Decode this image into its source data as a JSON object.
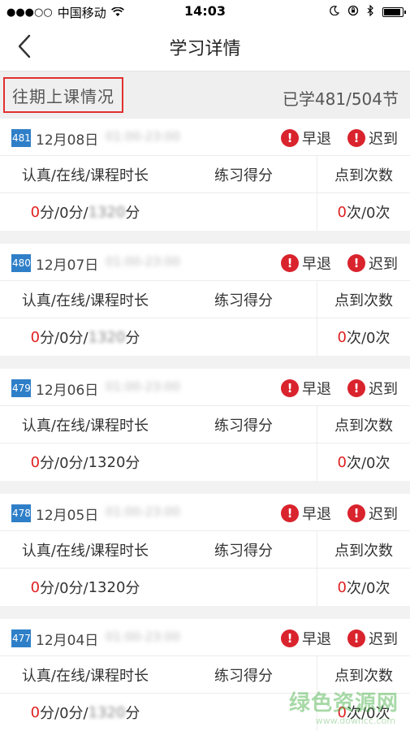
{
  "status_bar": {
    "signal": "●●●○○",
    "carrier": "中国移动",
    "time": "14:03",
    "battery_level": 0.9
  },
  "nav": {
    "title": "学习详情"
  },
  "summary": {
    "history_label": "往期上课情况",
    "progress_text": "已学481/504节"
  },
  "columns": {
    "duration": "认真/在线/课程时长",
    "score": "练习得分",
    "checkin": "点到次数"
  },
  "flags": {
    "leave_early": "早退",
    "late": "迟到",
    "mark": "!"
  },
  "lessons": [
    {
      "number": "481",
      "date": "12月08日",
      "time": "01:00-23:00",
      "duration_red": "0",
      "duration_rest": "分/0分/",
      "course_minutes": "1320",
      "unit_min": "分",
      "score": "",
      "checkin_red": "0",
      "checkin_rest": "次/0次"
    },
    {
      "number": "480",
      "date": "12月07日",
      "time": "01:00-23:00",
      "duration_red": "0",
      "duration_rest": "分/0分/",
      "course_minutes": "1320",
      "unit_min": "分",
      "score": "",
      "checkin_red": "0",
      "checkin_rest": "次/0次"
    },
    {
      "number": "479",
      "date": "12月06日",
      "time": "01:00-23:00",
      "duration_red": "0",
      "duration_rest": "分/0分/",
      "course_minutes": "1320",
      "unit_min": "分",
      "score": "",
      "checkin_red": "0",
      "checkin_rest": "次/0次"
    },
    {
      "number": "478",
      "date": "12月05日",
      "time": "01:00-23:00",
      "duration_red": "0",
      "duration_rest": "分/0分/",
      "course_minutes": "1320",
      "unit_min": "分",
      "score": "",
      "checkin_red": "0",
      "checkin_rest": "次/0次"
    },
    {
      "number": "477",
      "date": "12月04日",
      "time": "01:00-23:00",
      "duration_red": "0",
      "duration_rest": "分/0分/",
      "course_minutes": "1320",
      "unit_min": "分",
      "score": "",
      "checkin_red": "0",
      "checkin_rest": "次/0次"
    }
  ],
  "watermark": {
    "text": "绿色资源网",
    "sub": "www.downcc.com"
  },
  "colors": {
    "badge": "#2f7fc8",
    "alert": "#d9232d",
    "highlight_border": "#e03030",
    "zero_value": "#e02020"
  }
}
